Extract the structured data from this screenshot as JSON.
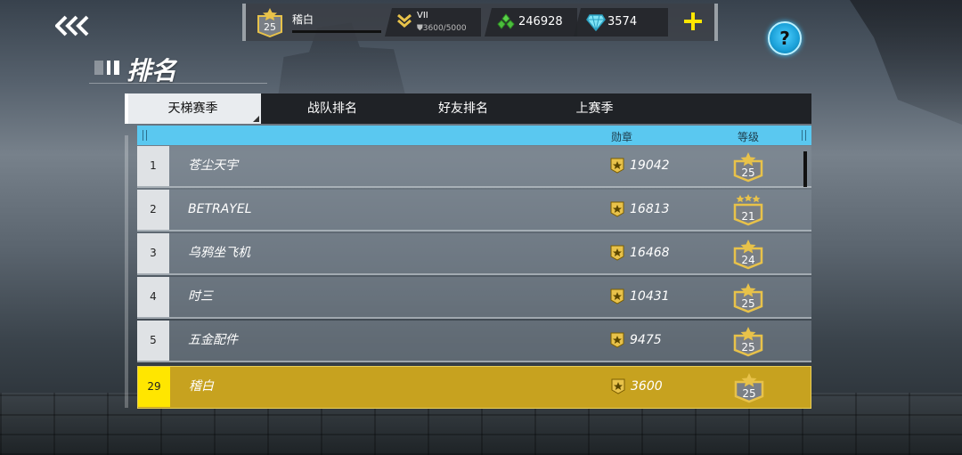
{
  "player": {
    "name": "稽白",
    "level": "25",
    "rank_name": "VII",
    "rank_progress": "3600/5000"
  },
  "currencies": [
    {
      "name": "green-crystal",
      "value": "246928"
    },
    {
      "name": "diamond",
      "value": "3574"
    }
  ],
  "page_title": "排名",
  "tabs": [
    "天梯赛季",
    "战队排名",
    "好友排名",
    "上赛季"
  ],
  "headers": {
    "medals": "勋章",
    "level": "等级"
  },
  "rows": [
    {
      "rank": "1",
      "name": "苍尘天宇",
      "medals": "19042",
      "level": "25"
    },
    {
      "rank": "2",
      "name": "BETRAYEL",
      "medals": "16813",
      "level": "21"
    },
    {
      "rank": "3",
      "name": "乌鸦坐飞机",
      "medals": "16468",
      "level": "24"
    },
    {
      "rank": "4",
      "name": "时三",
      "medals": "10431",
      "level": "25"
    },
    {
      "rank": "5",
      "name": "五金配件",
      "medals": "9475",
      "level": "25"
    }
  ],
  "self_row": {
    "rank": "29",
    "name": "稽白",
    "medals": "3600",
    "level": "25"
  },
  "colors": {
    "header_bg": "#5ac8f0",
    "self_row_bg": "#c7a21f",
    "self_rank_bg": "#ffe600",
    "badge_gold": "#e8c24a",
    "help_button": "#1aa0d8"
  },
  "icons": {
    "back": "double-chevron-left-icon",
    "medal": "medal-star-icon",
    "rank": "rank-chevron-icon",
    "crystal": "green-crystal-icon",
    "diamond": "diamond-icon",
    "add": "plus-icon",
    "help": "question-icon"
  }
}
